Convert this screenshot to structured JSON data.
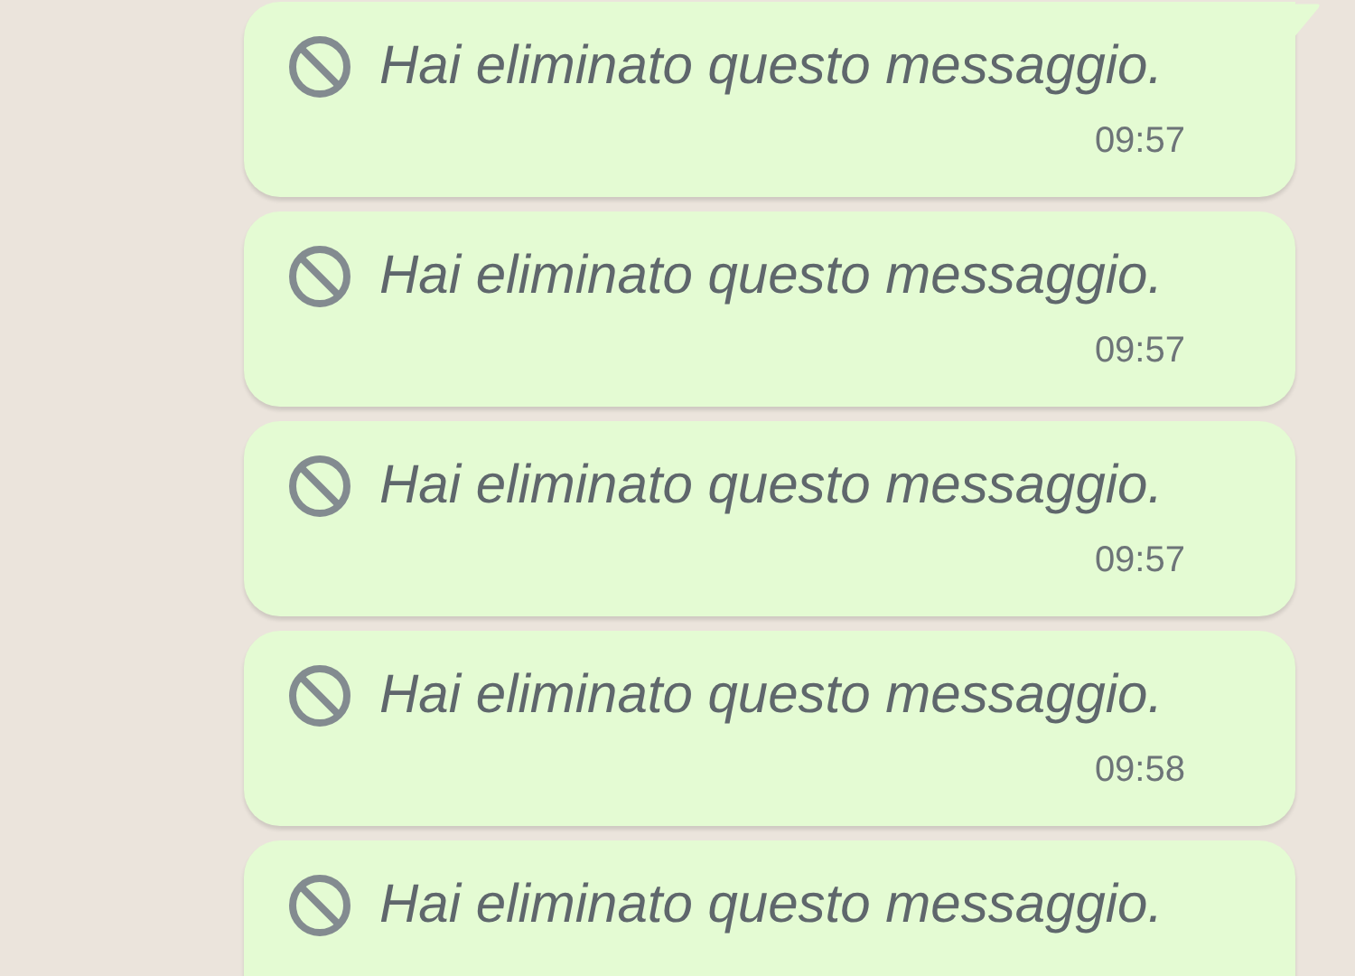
{
  "messages": [
    {
      "kind": "deleted",
      "text": "Hai eliminato questo messaggio.",
      "time": "09:57",
      "tail": true
    },
    {
      "kind": "deleted",
      "text": "Hai eliminato questo messaggio.",
      "time": "09:57",
      "tail": false
    },
    {
      "kind": "deleted",
      "text": "Hai eliminato questo messaggio.",
      "time": "09:57",
      "tail": false
    },
    {
      "kind": "deleted",
      "text": "Hai eliminato questo messaggio.",
      "time": "09:58",
      "tail": false
    },
    {
      "kind": "deleted",
      "text": "Hai eliminato questo messaggio.",
      "tail": false
    }
  ]
}
